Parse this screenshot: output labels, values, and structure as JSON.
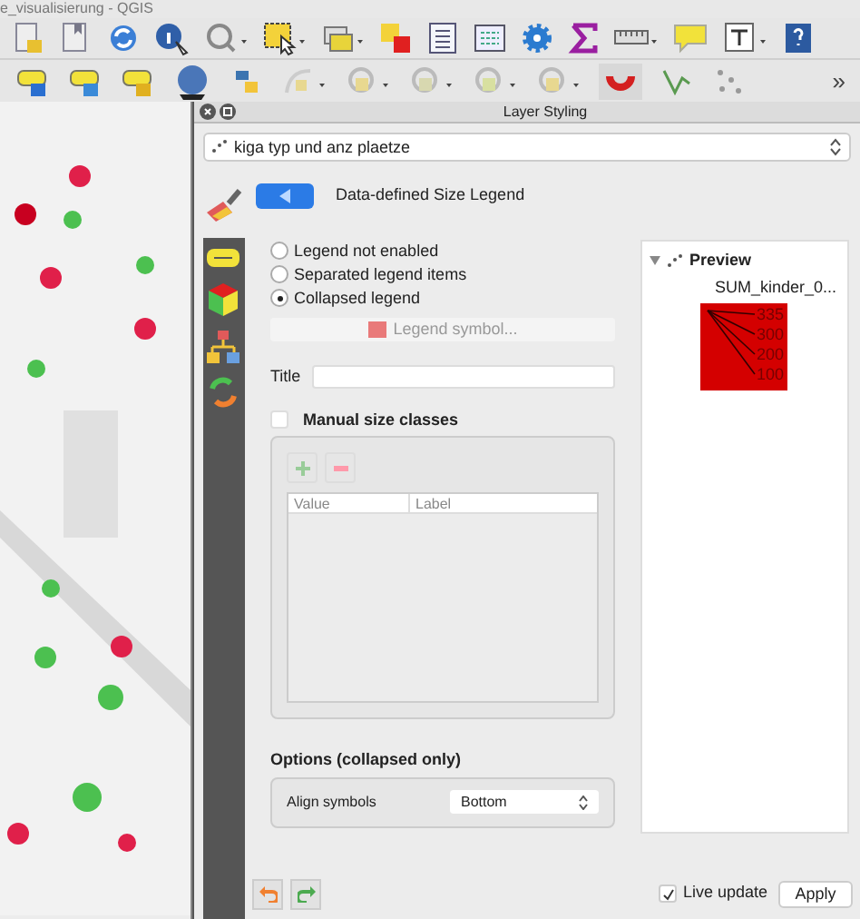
{
  "window": {
    "title": "e_visualisierung - QGIS"
  },
  "toolbar_overflow": "»",
  "panel": {
    "title": "Layer Styling",
    "layer": "kiga typ und anz plaetze",
    "section_title": "Data-defined Size Legend",
    "legend_modes": [
      {
        "label": "Legend not enabled",
        "selected": false
      },
      {
        "label": "Separated legend items",
        "selected": false
      },
      {
        "label": "Collapsed legend",
        "selected": true
      }
    ],
    "legend_symbol_button": "Legend symbol...",
    "title_label": "Title",
    "manual_classes": {
      "label": "Manual size classes",
      "checked": false
    },
    "table_columns": [
      "Value",
      "Label"
    ],
    "preview": {
      "title": "Preview",
      "expanded": true,
      "layer_label": "SUM_kinder_0...",
      "legend_values": [
        "335",
        "300",
        "200",
        "100"
      ]
    },
    "options": {
      "title": "Options (collapsed only)",
      "align_label": "Align symbols",
      "align_value": "Bottom"
    },
    "live_update": {
      "label": "Live update",
      "checked": true
    },
    "apply_button": "Apply"
  }
}
